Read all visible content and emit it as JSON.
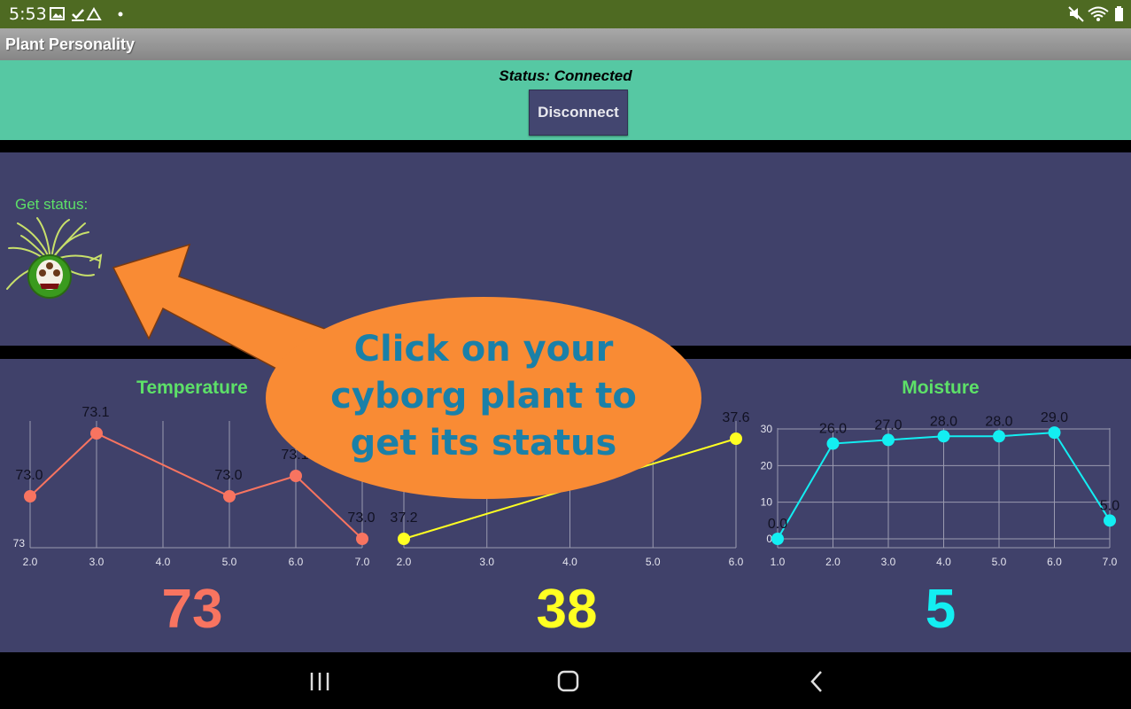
{
  "statusbar": {
    "time": "5:53"
  },
  "app": {
    "title": "Plant Personality"
  },
  "connection": {
    "status": "Status: Connected",
    "button_label": "Disconnect"
  },
  "plant": {
    "get_status_label": "Get status:"
  },
  "callout": {
    "lines": [
      "Click on your",
      "cyborg plant to",
      "get its status"
    ]
  },
  "colors": {
    "temperature": "#f87460",
    "light": "#ffff22",
    "moisture": "#13eef2",
    "title_green": "#5de068",
    "panel": "#40416a",
    "connect_panel": "#56c8a3",
    "callout": "#f98b34"
  },
  "readings": {
    "temperature": "73",
    "light": "38",
    "moisture": "5"
  },
  "chart_data": [
    {
      "type": "line",
      "title": "Temperature",
      "x": [
        2.0,
        3.0,
        5.0,
        6.0,
        7.0
      ],
      "y": [
        73.0,
        73.1,
        73.0,
        73.1,
        73.0
      ],
      "data_labels": [
        "73.0",
        "73.1",
        "73.0",
        "73.1",
        "73.0"
      ],
      "x_ticks": [
        "2.0",
        "3.0",
        "4.0",
        "5.0",
        "6.0",
        "7.0"
      ],
      "y_ticks": [
        "73"
      ]
    },
    {
      "type": "line",
      "title": "",
      "x": [
        2.0,
        6.0
      ],
      "y": [
        37.2,
        37.6
      ],
      "data_labels": [
        "37.2",
        "37.6"
      ],
      "x_ticks": [
        "2.0",
        "3.0",
        "4.0",
        "5.0",
        "6.0"
      ],
      "y_ticks": []
    },
    {
      "type": "line",
      "title": "Moisture",
      "x": [
        1.0,
        2.0,
        3.0,
        4.0,
        5.0,
        6.0,
        7.0
      ],
      "y": [
        0.0,
        26.0,
        27.0,
        28.0,
        28.0,
        29.0,
        5.0
      ],
      "data_labels": [
        "0.0",
        "26.0",
        "27.0",
        "28.0",
        "28.0",
        "29.0",
        "5.0"
      ],
      "x_ticks": [
        "1.0",
        "2.0",
        "3.0",
        "4.0",
        "5.0",
        "6.0",
        "7.0"
      ],
      "y_ticks": [
        "0",
        "10",
        "20",
        "30"
      ]
    }
  ]
}
